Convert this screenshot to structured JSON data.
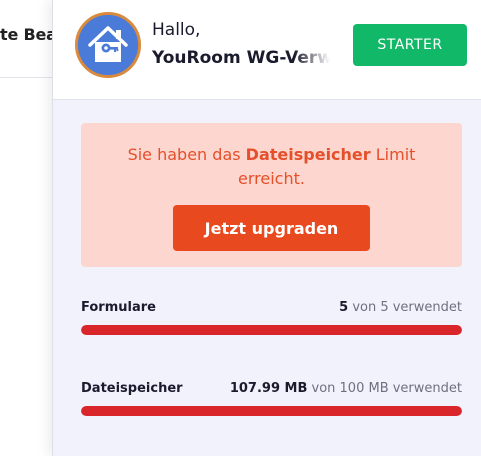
{
  "background": {
    "tab_text": "te Bea"
  },
  "header": {
    "greeting": "Hallo,",
    "username": "YouRoom WG-Verwa",
    "plan_button": "STARTER",
    "avatar_icon": "house-key-icon"
  },
  "alert": {
    "text_before": "Sie haben das ",
    "text_bold": "Dateispeicher",
    "text_after": " Limit erreicht.",
    "button": "Jetzt upgraden"
  },
  "usage": [
    {
      "label": "Formulare",
      "value": "5",
      "suffix": " von 5 verwendet",
      "fill_fraction": 1.0
    },
    {
      "label": "Dateispeicher",
      "value": "107.99 MB",
      "suffix": " von 100 MB verwendet",
      "fill_fraction": 1.0
    }
  ],
  "colors": {
    "plan_button": "#11b868",
    "alert_background": "#fdd6cf",
    "alert_text": "#e4502a",
    "upgrade_button": "#e8491e",
    "usage_bar": "#d9262b",
    "avatar_background": "#4b7bd8",
    "avatar_ring": "#d98a3c"
  }
}
